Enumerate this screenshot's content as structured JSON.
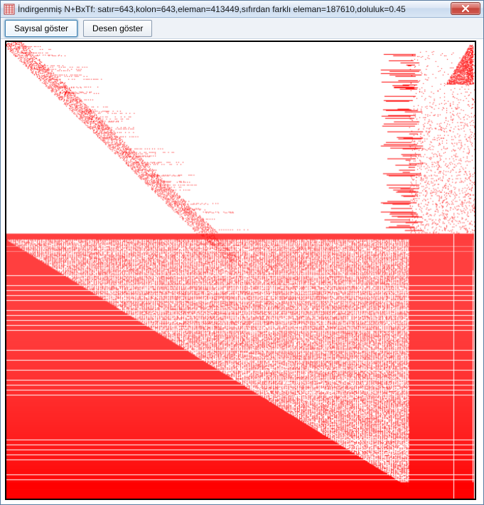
{
  "window": {
    "title": "İndirgenmiş N+BxTf: satır=643,kolon=643,eleman=413449,sıfırdan farklı eleman=187610,doluluk=0.45",
    "close_label": "Close"
  },
  "toolbar": {
    "numeric_label": "Sayısal göster",
    "pattern_label": "Desen göster"
  },
  "matrix": {
    "rows": 643,
    "cols": 643,
    "elements": 413449,
    "nonzero": 187610,
    "fill": 0.45,
    "pattern_color": "#ff0000",
    "pattern": {
      "description": "Sparse matrix spy plot. Upper half: dotted band near main diagonal plus a vertical cluster of nonzeros near the right edge. Lower half: dense lower-triangular fill below a mid-level row, with heavy vertical bands near right edge."
    }
  }
}
